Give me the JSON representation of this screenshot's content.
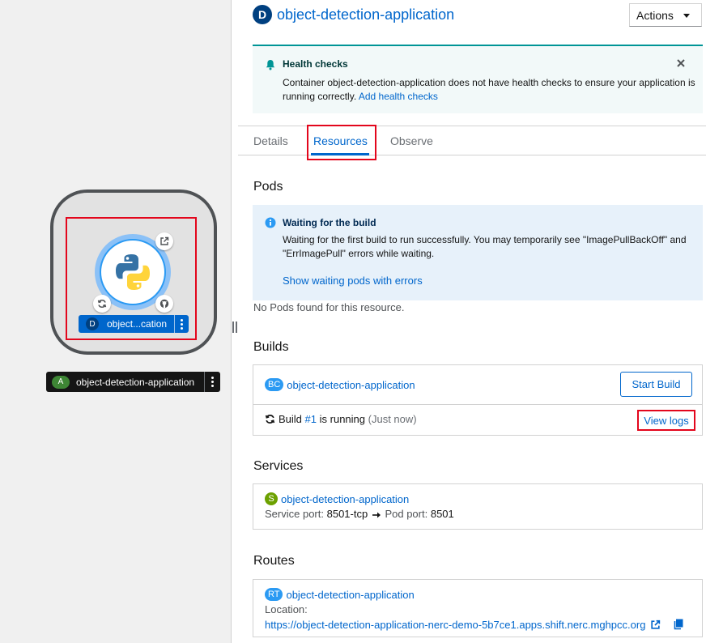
{
  "topology": {
    "node": {
      "badge": "D",
      "label": "object...cation"
    },
    "application": {
      "badge": "A",
      "label": "object-detection-application"
    }
  },
  "panel": {
    "badge": "D",
    "title": "object-detection-application",
    "actions_label": "Actions",
    "health_alert": {
      "title": "Health checks",
      "body": "Container object-detection-application does not have health checks to ensure your application is running correctly.",
      "link": "Add health checks"
    },
    "tabs": [
      {
        "label": "Details"
      },
      {
        "label": "Resources"
      },
      {
        "label": "Observe"
      }
    ],
    "active_tab": "Resources",
    "pods": {
      "title": "Pods",
      "alert_title": "Waiting for the build",
      "alert_body": "Waiting for the first build to run successfully. You may temporarily see \"ImagePullBackOff\" and \"ErrImagePull\" errors while waiting.",
      "alert_link": "Show waiting pods with errors",
      "empty": "No Pods found for this resource."
    },
    "builds": {
      "title": "Builds",
      "badge": "BC",
      "name": "object-detection-application",
      "start_label": "Start Build",
      "status_prefix": "Build",
      "build_number": "#1",
      "status_suffix": "is running",
      "time": "(Just now)",
      "view_logs": "View logs"
    },
    "services": {
      "title": "Services",
      "badge": "S",
      "name": "object-detection-application",
      "service_port_label": "Service port:",
      "service_port": "8501-tcp",
      "pod_port_label": "Pod port:",
      "pod_port": "8501"
    },
    "routes": {
      "title": "Routes",
      "badge": "RT",
      "name": "object-detection-application",
      "location_label": "Location:",
      "url": "https://object-detection-application-nerc-demo-5b7ce1.apps.shift.nerc.mghpcc.org"
    }
  },
  "colors": {
    "link": "#0066cc",
    "highlight": "#e3061c",
    "health_alert_bg": "#f2f9f9",
    "info_alert_bg": "#e7f1fa",
    "deployment_badge": "#004080",
    "application_badge": "#3e8635",
    "service_badge": "#6ca100",
    "build_badge": "#2b9af3"
  },
  "icons": [
    "python-logo-icon",
    "external-link-icon",
    "sync-icon",
    "github-icon",
    "kebab-icon",
    "bell-icon",
    "close-icon",
    "info-circle-icon",
    "caret-down-icon",
    "long-arrow-right-icon",
    "copy-icon"
  ]
}
